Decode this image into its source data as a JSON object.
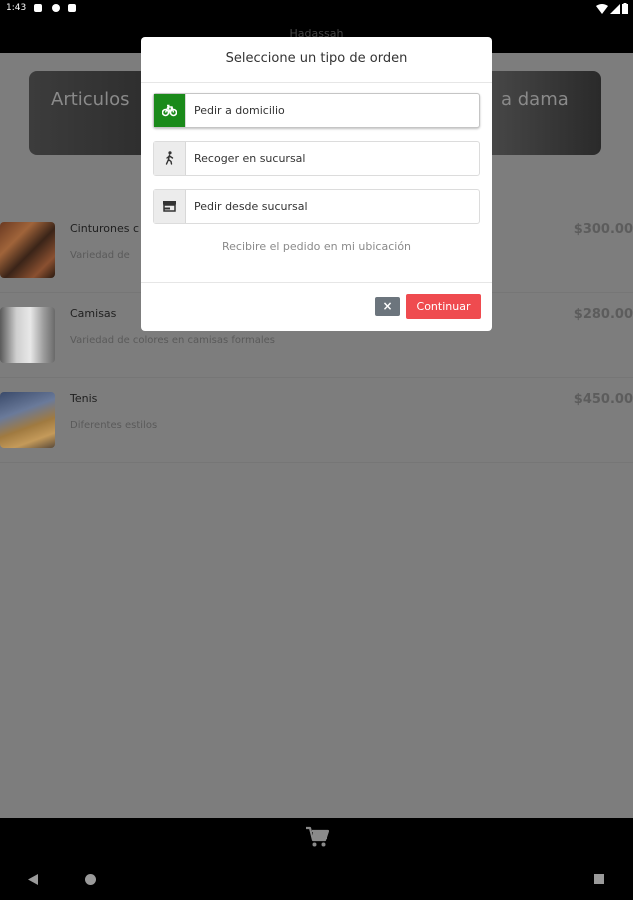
{
  "status_bar": {
    "time": "1:43"
  },
  "app": {
    "title": "Hadassah"
  },
  "banner": {
    "left_text": "Articulos",
    "right_text": "a dama"
  },
  "products": [
    {
      "name": "Cinturones c",
      "description": "Variedad de",
      "price": "$300.00"
    },
    {
      "name": "Camisas",
      "description": "Variedad de colores en camisas formales",
      "price": "$280.00"
    },
    {
      "name": "Tenis",
      "description": "Diferentes estilos",
      "price": "$450.00"
    }
  ],
  "modal": {
    "title": "Seleccione un tipo de orden",
    "options": [
      {
        "label": "Pedir a domicilio",
        "icon": "bicycle-icon",
        "selected": true
      },
      {
        "label": "Recoger en sucursal",
        "icon": "walking-icon",
        "selected": false
      },
      {
        "label": "Pedir desde sucursal",
        "icon": "store-icon",
        "selected": false
      }
    ],
    "hint": "Recibire el pedido en mi ubicación",
    "close_label": "×",
    "continue_label": "Continuar"
  },
  "colors": {
    "selected": "#1a8a1a",
    "continue": "#ef4b4f",
    "close": "#6c757d"
  }
}
